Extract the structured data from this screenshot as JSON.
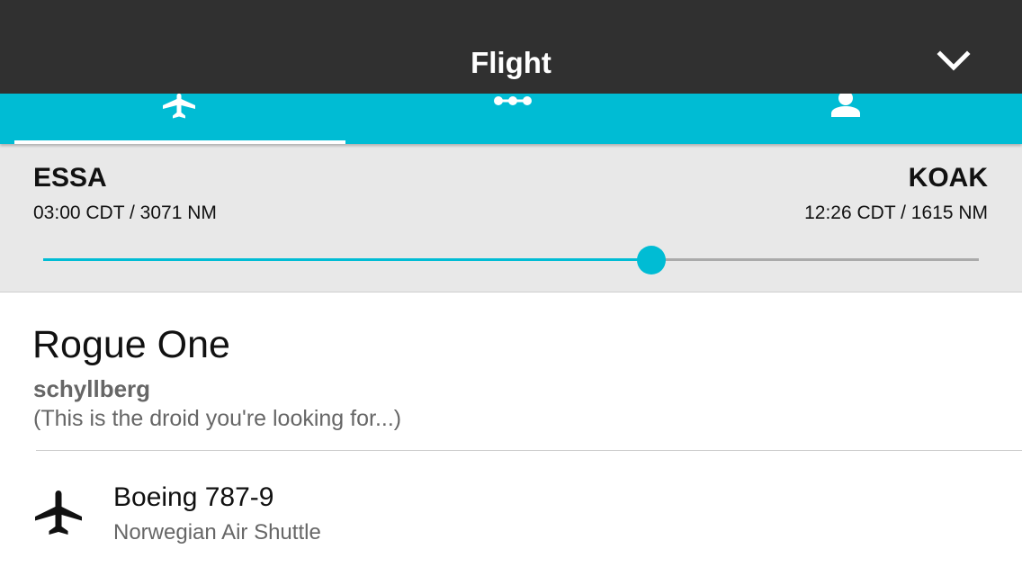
{
  "header": {
    "title": "Flight",
    "collapse_icon": "chevron-down-icon"
  },
  "tabs": [
    {
      "icon": "airplane-icon",
      "selected": true
    },
    {
      "icon": "route-waypoints-icon",
      "selected": false
    },
    {
      "icon": "person-icon",
      "selected": false
    }
  ],
  "route": {
    "origin": {
      "code": "ESSA",
      "info": "03:00 CDT / 3071 NM"
    },
    "destination": {
      "code": "KOAK",
      "info": "12:26 CDT / 1615 NM"
    },
    "progress": 0.65
  },
  "flight": {
    "name": "Rogue One",
    "user": "schyllberg",
    "tagline": "(This is the droid you're looking for...)"
  },
  "aircraft": {
    "icon": "airplane-icon",
    "type": "Boeing 787-9",
    "airline": "Norwegian Air Shuttle"
  },
  "colors": {
    "header_bg": "#303030",
    "accent": "#00bcd4",
    "route_bg": "#e8e8e8"
  }
}
